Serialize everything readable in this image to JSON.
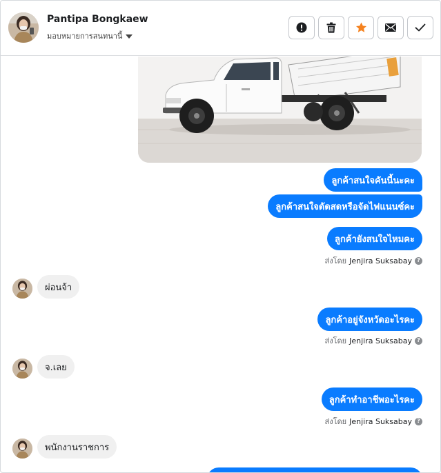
{
  "header": {
    "contact_name": "Pantipa Bongkaew",
    "assign_label": "มอบหมายการสนทนานี้",
    "actions": [
      {
        "name": "mark-spam-button",
        "icon": "exclamation-icon"
      },
      {
        "name": "delete-button",
        "icon": "trash-icon"
      },
      {
        "name": "star-button",
        "icon": "star-icon"
      },
      {
        "name": "mark-unread-button",
        "icon": "envelope-icon"
      },
      {
        "name": "mark-done-button",
        "icon": "check-icon"
      }
    ]
  },
  "conversation": {
    "outgoing_1": "ลูกค้าสนใจคันนี้นะคะ",
    "outgoing_2": "ลูกค้าสนใจดัดสดหรือจัดไฟแนนซ์คะ",
    "outgoing_3": "ลูกค้ายังสนใจไหมคะ",
    "incoming_1": "ผ่อนจ้า",
    "outgoing_4": "ลูกค้าอยู่จังหวัดอะไรคะ",
    "incoming_2": "จ.เลย",
    "outgoing_5": "ลูกค้าทำอาชีพอะไรคะ",
    "incoming_3": "พนักงานราชการ",
    "sent_by_prefix": "ส่งโดย",
    "sent_by_name": "Jenjira Suksabay"
  },
  "colors": {
    "outgoing_bubble": "#0a7cff",
    "incoming_bubble": "#f0f0f0",
    "star": "#f5821f"
  }
}
